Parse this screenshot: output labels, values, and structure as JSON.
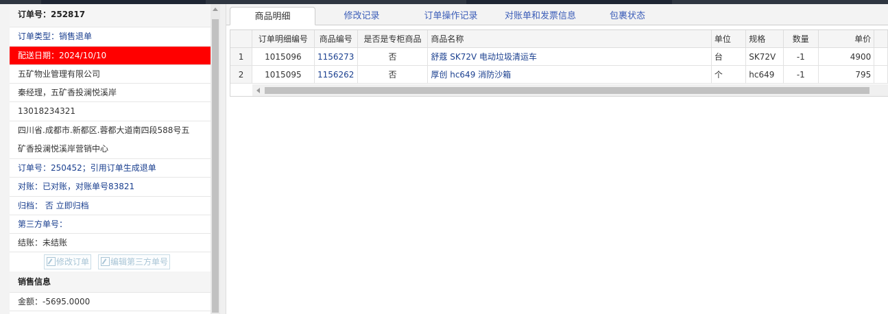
{
  "order_panel": {
    "order_no": "订单号：252817",
    "order_type": "订单类型：销售退单",
    "delivery_date": "配送日期：2024/10/10",
    "company": "五矿物业管理有限公司",
    "contact": "秦经理，五矿香投澜悦溪岸",
    "phone": "13018234321",
    "address_line1": "四川省.成都市.新都区.蓉都大道南四段588号五",
    "address_line2": "矿香投澜悦溪岸营销中心",
    "ref_order": "订单号：250452；引用订单生成退单",
    "reconcile": "对账：已对账，对账单号83821",
    "archive": "归档： 否 立即归档",
    "third_party": "第三方单号：",
    "settlement": "结账：未结账",
    "edit_order_button": "修改订单",
    "edit_third_party_button": "编辑第三方单号",
    "sales_header": "销售信息",
    "amount": "金额：-5695.0000",
    "highlight_color": "#ff0000"
  },
  "tabs": [
    "商品明细",
    "修改记录",
    "订单操作记录",
    "对账单和发票信息",
    "包裹状态"
  ],
  "grid": {
    "columns": [
      "订单明细编号",
      "商品编号",
      "是否是专柜商品",
      "商品名称",
      "单位",
      "规格",
      "数量",
      "单价"
    ],
    "rows": [
      {
        "rownum": "1",
        "detail_no": "1015096",
        "product_no": "1156273",
        "counter": "否",
        "name": "舒蔻 SK72V 电动垃圾清运车",
        "unit": "台",
        "spec": "SK72V",
        "qty": "-1",
        "price": "4900"
      },
      {
        "rownum": "2",
        "detail_no": "1015095",
        "product_no": "1156262",
        "counter": "否",
        "name": "厚创 hc649 消防沙箱",
        "unit": "个",
        "spec": "hc649",
        "qty": "-1",
        "price": "795"
      }
    ]
  }
}
